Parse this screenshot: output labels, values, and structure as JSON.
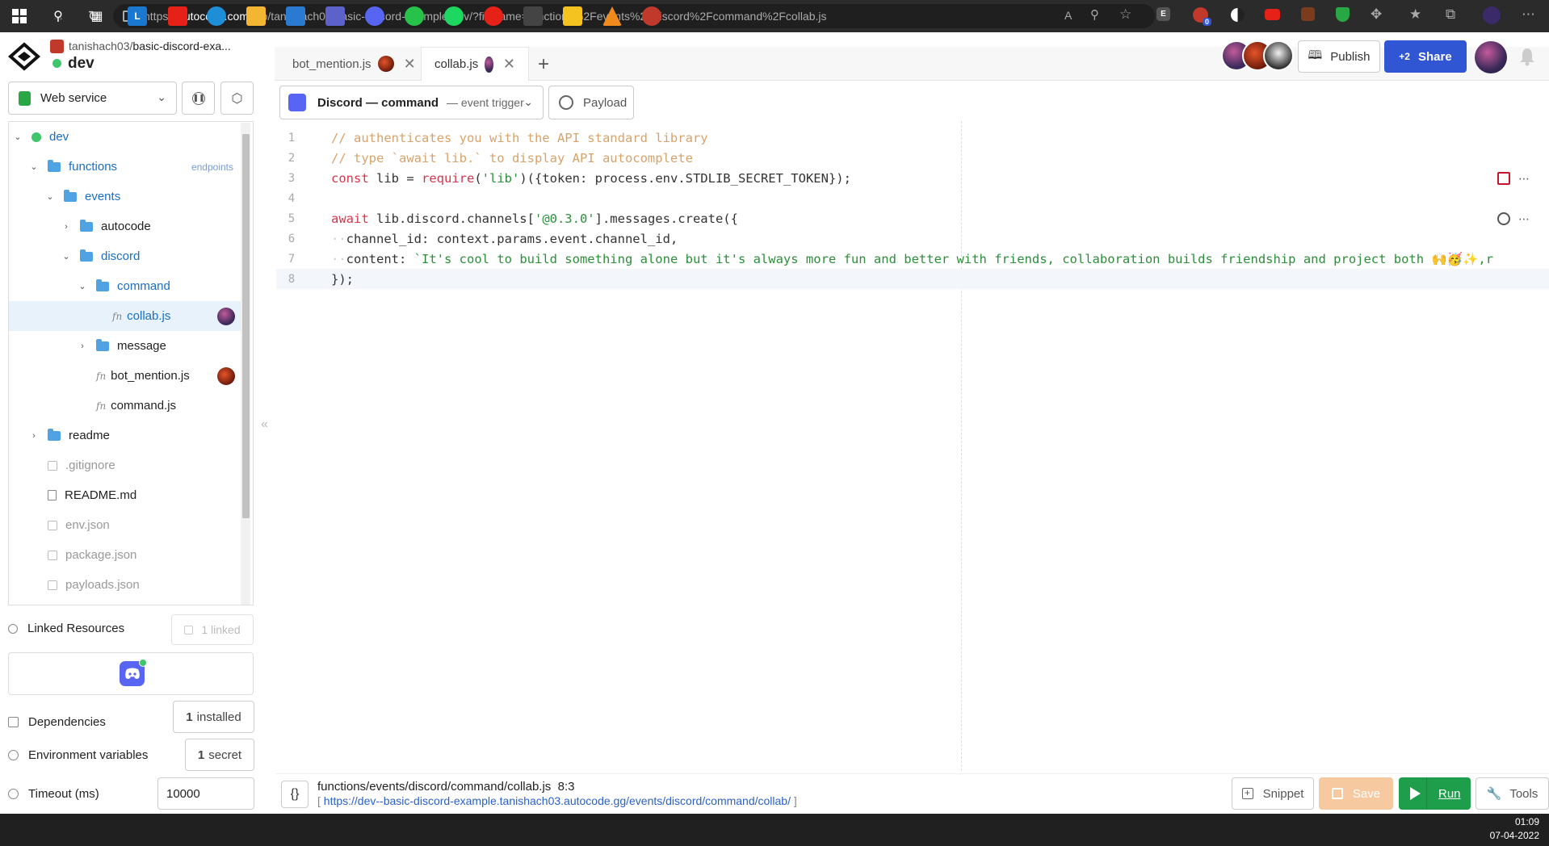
{
  "browser": {
    "url_scheme": "https://",
    "url_host": "autocode.com",
    "url_path": "/mp/tanishach03/basic-discord-example/dev/?filename=functions%2Fevents%2Fdiscord%2Fcommand%2Fcollab.js",
    "extension_badge": "0"
  },
  "project": {
    "owner": "tanishach03/",
    "name": "basic-discord-exa...",
    "environment": "dev"
  },
  "tabs": [
    {
      "label": "bot_mention.js"
    },
    {
      "label": "collab.js"
    }
  ],
  "header": {
    "publish_label": "Publish",
    "share_count": "+2",
    "share_label": "Share"
  },
  "sidebar": {
    "service_type": "Web service",
    "tree": {
      "root": "dev",
      "functions": "functions",
      "endpoints_label": "endpoints",
      "events": "events",
      "autocode": "autocode",
      "discord": "discord",
      "command": "command",
      "collab": "collab.js",
      "message": "message",
      "bot_mention": "bot_mention.js",
      "command_js": "command.js",
      "readme": "readme",
      "gitignore": ".gitignore",
      "readme_md": "README.md",
      "env_json": "env.json",
      "package_json": "package.json",
      "payloads_json": "payloads.json"
    },
    "linked_resources_label": "Linked Resources",
    "linked_count": "1 linked",
    "dependencies_label": "Dependencies",
    "dependencies_count": "1",
    "dependencies_suffix": "installed",
    "env_vars_label": "Environment variables",
    "env_vars_count": "1",
    "env_vars_suffix": "secret",
    "timeout_label": "Timeout (ms)",
    "timeout_value": "10000"
  },
  "editor": {
    "trigger_name": "Discord — command",
    "trigger_type": "— event trigger",
    "payload_label": "Payload",
    "line_numbers": [
      "1",
      "2",
      "3",
      "4",
      "5",
      "6",
      "7",
      "8"
    ],
    "lines": {
      "l1": "// authenticates you with the API standard library",
      "l2": "// type `await lib.` to display API autocomplete",
      "l3_kw": "const",
      "l3_a": " lib = ",
      "l3_req": "require",
      "l3_b": "(",
      "l3_str": "'lib'",
      "l3_c": ")({token: process.env.STDLIB_SECRET_TOKEN});",
      "l5_kw": "await",
      "l5_a": " lib.discord.channels[",
      "l5_str": "'@0.3.0'",
      "l5_b": "].messages.create({",
      "l6_dots": "··",
      "l6": "channel_id: context.params.event.channel_id,",
      "l7_dots": "··",
      "l7_a": "content: ",
      "l7_str": "`It's cool to build something alone but it's always more fun and better with friends, collaboration builds friendship and project both 🙌🥳✨,r",
      "l8": "});"
    }
  },
  "status": {
    "file_path": "functions/events/discord/command/collab.js",
    "cursor": "8:3",
    "url_open": "[ ",
    "endpoint_url": "https://dev--basic-discord-example.tanishach03.autocode.gg/events/discord/command/collab/",
    "url_close": " ]",
    "snippet_label": "Snippet",
    "save_label": "Save",
    "run_label": "Run",
    "tools_label": "Tools"
  },
  "taskbar": {
    "time": "01:09",
    "date": "07-04-2022"
  },
  "colors": {
    "accent": "#3156d3",
    "run_green": "#1e9e4a",
    "save_orange": "#f7c9a1",
    "discord": "#5865f2"
  }
}
